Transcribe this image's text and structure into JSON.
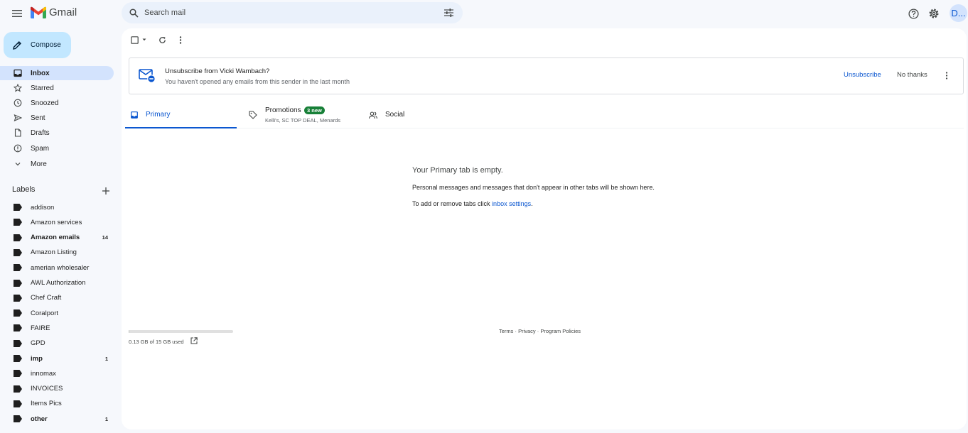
{
  "header": {
    "app_name": "Gmail",
    "search_placeholder": "Search mail",
    "avatar_text": "D..."
  },
  "sidebar": {
    "compose_label": "Compose",
    "nav": [
      {
        "label": "Inbox",
        "icon": "inbox-icon",
        "active": true
      },
      {
        "label": "Starred",
        "icon": "star-icon"
      },
      {
        "label": "Snoozed",
        "icon": "clock-icon"
      },
      {
        "label": "Sent",
        "icon": "send-icon"
      },
      {
        "label": "Drafts",
        "icon": "draft-icon"
      },
      {
        "label": "Spam",
        "icon": "spam-icon"
      },
      {
        "label": "More",
        "icon": "chevron-down-icon"
      }
    ],
    "labels_title": "Labels",
    "labels": [
      {
        "name": "addison",
        "count": ""
      },
      {
        "name": "Amazon services",
        "count": ""
      },
      {
        "name": "Amazon emails",
        "count": "14",
        "bold": true
      },
      {
        "name": "Amazon Listing",
        "count": ""
      },
      {
        "name": "amerian wholesaler",
        "count": ""
      },
      {
        "name": "AWL Authorization",
        "count": ""
      },
      {
        "name": "Chef Craft",
        "count": ""
      },
      {
        "name": "Coralport",
        "count": ""
      },
      {
        "name": "FAIRE",
        "count": ""
      },
      {
        "name": "GPD",
        "count": ""
      },
      {
        "name": "imp",
        "count": "1",
        "bold": true
      },
      {
        "name": "innomax",
        "count": ""
      },
      {
        "name": "INVOICES",
        "count": ""
      },
      {
        "name": "Items Pics",
        "count": ""
      },
      {
        "name": "other",
        "count": "1",
        "bold": true
      }
    ]
  },
  "banner": {
    "title": "Unsubscribe from Vicki Wambach?",
    "subtitle": "You haven't opened any emails from this sender in the last month",
    "unsubscribe_label": "Unsubscribe",
    "no_thanks_label": "No thanks"
  },
  "tabs": {
    "primary": "Primary",
    "promotions": "Promotions",
    "promotions_badge": "3 new",
    "promotions_senders": "Kelli's, SC TOP DEAL, Menards",
    "social": "Social"
  },
  "empty": {
    "title": "Your Primary tab is empty.",
    "line1": "Personal messages and messages that don't appear in other tabs will be shown here.",
    "line2_prefix": "To add or remove tabs click ",
    "line2_link": "inbox settings",
    "line2_suffix": "."
  },
  "footer": {
    "storage_text": "0.13 GB of 15 GB used",
    "storage_fraction": 0.009,
    "terms": "Terms",
    "privacy": "Privacy",
    "policies": "Program Policies",
    "separator": " · "
  },
  "colors": {
    "accent": "#0b57d0",
    "compose_bg": "#c2e7ff",
    "active_nav": "#d3e3fd",
    "badge_green": "#188038"
  }
}
